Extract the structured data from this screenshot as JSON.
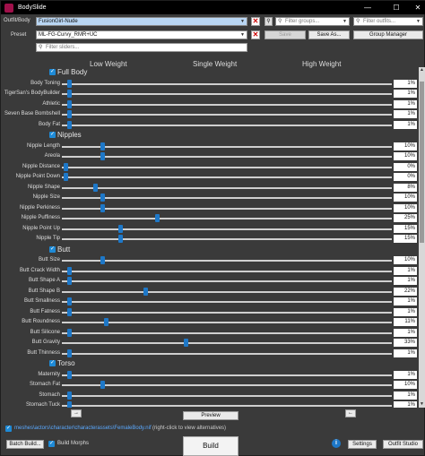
{
  "window": {
    "title": "BodySlide",
    "minimize": "—",
    "maximize": "☐",
    "close": "✕"
  },
  "top": {
    "outfit_label": "Outfit/Body",
    "outfit_value": "FusionGirl-Nude",
    "groups_placeholder": "Filter groups...",
    "outfits_placeholder": "Filter outfits...",
    "preset_label": "Preset",
    "preset_value": "ML-FG-Curvy_RMR+UC",
    "save": "Save",
    "save_as": "Save As...",
    "group_manager": "Group Manager",
    "sliders_placeholder": "Filter sliders..."
  },
  "columns": {
    "low": "Low Weight",
    "single": "Single Weight",
    "high": "High Weight"
  },
  "groups": [
    {
      "name": "Full Body",
      "sliders": [
        {
          "name": "Body Toning",
          "value": 1
        },
        {
          "name": "TigerSan's BodyBuilder",
          "value": 1
        },
        {
          "name": "Athletic",
          "value": 1
        },
        {
          "name": "Seven Base Bombshell",
          "value": 1
        },
        {
          "name": "Body Fat",
          "value": 1
        }
      ]
    },
    {
      "name": "Nipples",
      "sliders": [
        {
          "name": "Nipple Length",
          "value": 10
        },
        {
          "name": "Areola",
          "value": 10
        },
        {
          "name": "Nipple Distance",
          "value": 0
        },
        {
          "name": "Nipple Point Down",
          "value": 0
        },
        {
          "name": "Nipple Shape",
          "value": 8
        },
        {
          "name": "Nipple Size",
          "value": 10
        },
        {
          "name": "Nipple Perkiness",
          "value": 10
        },
        {
          "name": "Nipple Puffiness",
          "value": 25
        },
        {
          "name": "Nipple Point Up",
          "value": 15
        },
        {
          "name": "Nipple Tip",
          "value": 15
        }
      ]
    },
    {
      "name": "Butt",
      "sliders": [
        {
          "name": "Butt Size",
          "value": 10
        },
        {
          "name": "Butt Crack Width",
          "value": 1
        },
        {
          "name": "Butt Shape A",
          "value": 1
        },
        {
          "name": "Butt Shape B",
          "value": 22
        },
        {
          "name": "Butt Smallness",
          "value": 1
        },
        {
          "name": "Butt Fatness",
          "value": 1
        },
        {
          "name": "Butt Roundness",
          "value": 11
        },
        {
          "name": "Butt Silicone",
          "value": 1
        },
        {
          "name": "Butt Gravity",
          "value": 33
        },
        {
          "name": "Butt Thinness",
          "value": 1
        }
      ]
    },
    {
      "name": "Torso",
      "sliders": [
        {
          "name": "Maternity",
          "value": 1
        },
        {
          "name": "Stomach Fat",
          "value": 10
        },
        {
          "name": "Stomach",
          "value": 1
        },
        {
          "name": "Stomach Tuck",
          "value": 1
        }
      ]
    }
  ],
  "bottom": {
    "prev": "→",
    "next": "←",
    "preview": "Preview",
    "path": "meshes\\actors\\character\\characterassets\\FemaleBody.nif",
    "hint": "(right-click to view alternatives)",
    "batch_build": "Batch Build...",
    "build_morphs": "Build Morphs",
    "build": "Build",
    "info": "i",
    "settings": "Settings",
    "outfit_studio": "Outfit Studio"
  },
  "colors": {
    "accent": "#1e78c8",
    "background": "#3a3a3a",
    "titlebar": "#000000"
  }
}
